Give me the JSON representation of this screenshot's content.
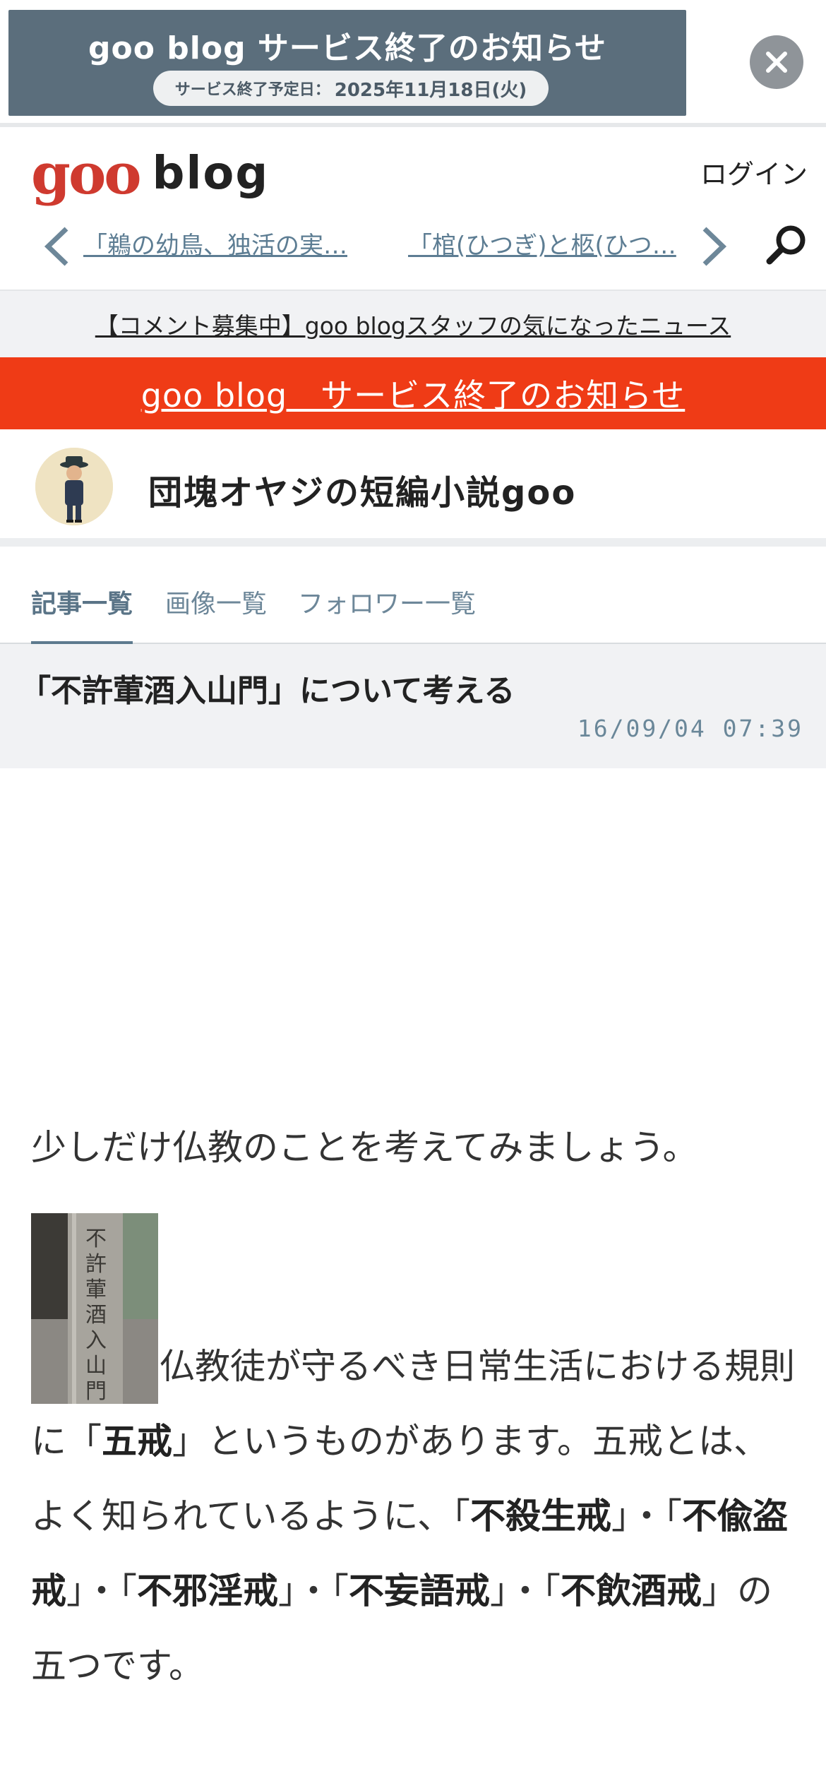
{
  "banner": {
    "title": "goo blog サービス終了のお知らせ",
    "end_label": "サービス終了予定日：",
    "end_date": "2025年11月18日(火)",
    "close_icon": "close-icon"
  },
  "header": {
    "logo_goo": "goo",
    "logo_blog": "blog",
    "login": "ログイン",
    "prev_article": "「鵜の幼鳥、独活の実…",
    "next_article": "「棺(ひつぎ)と柩(ひつ…",
    "search_icon": "search-icon"
  },
  "staff_news": "【コメント募集中】goo blogスタッフの気になったニュース",
  "red_notice": "goo blog　サービス終了のお知らせ",
  "blog": {
    "title": "団塊オヤジの短編小説goo"
  },
  "tabs": [
    {
      "label": "記事一覧",
      "active": true
    },
    {
      "label": "画像一覧",
      "active": false
    },
    {
      "label": "フォロワー一覧",
      "active": false
    }
  ],
  "article": {
    "title": "「不許葷酒入山門」について考える",
    "date": "16/09/04 07:39",
    "para1": "少しだけ仏教のことを考えてみましょう。",
    "para2_a": "仏教徒が守るべき日常生活における規則に「",
    "para2_b": "五戒",
    "para2_c": "」というものがあります。五戒とは、よく知られているように、「",
    "para2_d": "不殺生戒",
    "para2_e": "」・「",
    "para2_f": "不偸盗戒",
    "para2_g": "」・「",
    "para2_h": "不邪淫戒",
    "para2_i": "」・「",
    "para2_j": "不妄語戒",
    "para2_k": "」・「",
    "para2_l": "不飲酒戒",
    "para2_m": "」の五つです。",
    "stone_text": "不許葷酒入山門"
  },
  "colors": {
    "accent_red": "#ef3b16",
    "link_blue": "#5d7d93",
    "banner_slate": "#5b6e7c"
  }
}
